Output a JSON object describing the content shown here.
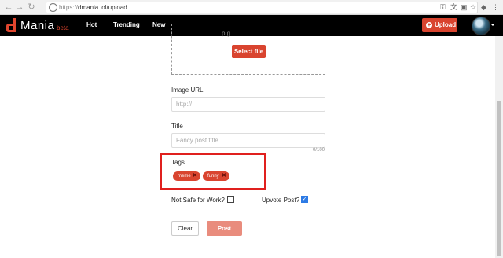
{
  "browser": {
    "url_scheme": "https://",
    "url_rest": "dmania.lol/upload",
    "secure_glyph": "i"
  },
  "header": {
    "logo_text": "Mania",
    "logo_badge": "beta",
    "nav": [
      "Hot",
      "Trending",
      "New"
    ],
    "upload_label": "Upload",
    "brand_color": "#d9442f"
  },
  "dropzone": {
    "partial_text": "p                g",
    "select_label": "Select file"
  },
  "image_url": {
    "label": "Image URL",
    "placeholder": "http://"
  },
  "title_field": {
    "label": "Title",
    "placeholder": "Fancy post title",
    "counter": "0/100"
  },
  "tags": {
    "label": "Tags",
    "items": [
      {
        "text": "meme",
        "remove": "✕"
      },
      {
        "text": "funny",
        "remove": "✕"
      }
    ]
  },
  "nsfw": {
    "label": "Not Safe for Work?",
    "checked": false
  },
  "upvote": {
    "label": "Upvote Post?",
    "checked": true,
    "check_glyph": "✓"
  },
  "actions": {
    "clear_label": "Clear",
    "post_label": "Post"
  }
}
